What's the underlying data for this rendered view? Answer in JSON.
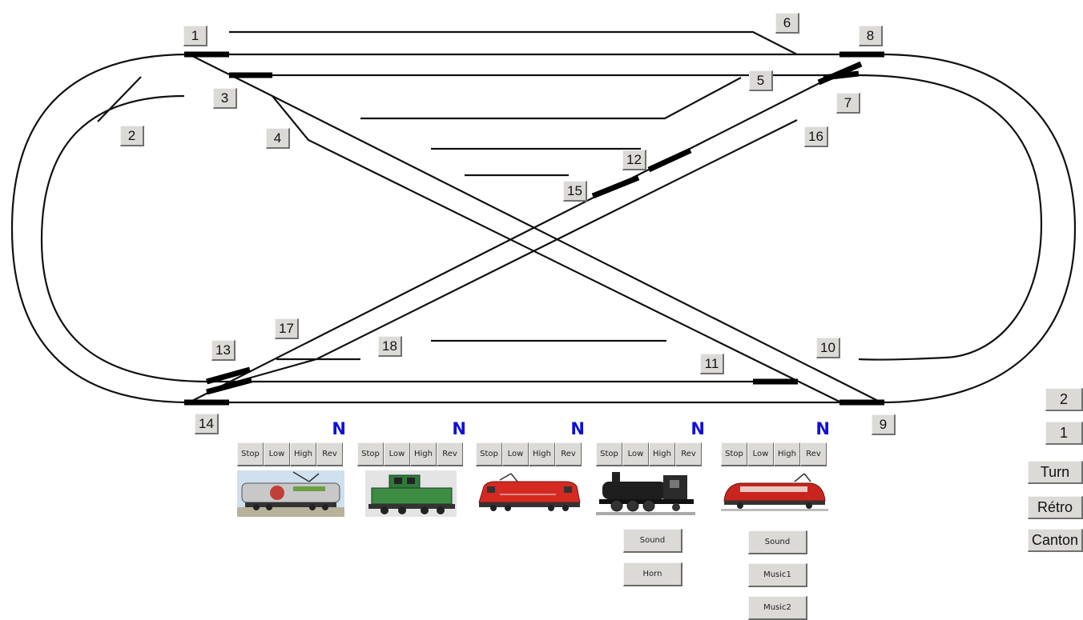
{
  "switches": [
    "1",
    "2",
    "3",
    "4",
    "5",
    "6",
    "7",
    "8",
    "9",
    "10",
    "11",
    "12",
    "13",
    "14",
    "15",
    "16",
    "17",
    "18"
  ],
  "locos": [
    {
      "direction": "N",
      "controls": [
        "Stop",
        "Low",
        "High",
        "Rev"
      ],
      "image": "locomotive-silver-electric",
      "extras": []
    },
    {
      "direction": "N",
      "controls": [
        "Stop",
        "Low",
        "High",
        "Rev"
      ],
      "image": "locomotive-green-diesel",
      "extras": []
    },
    {
      "direction": "N",
      "controls": [
        "Stop",
        "Low",
        "High",
        "Rev"
      ],
      "image": "locomotive-red-electric",
      "extras": []
    },
    {
      "direction": "N",
      "controls": [
        "Stop",
        "Low",
        "High",
        "Rev"
      ],
      "image": "locomotive-black-steam",
      "extras": [
        "Sound",
        "Horn"
      ]
    },
    {
      "direction": "N",
      "controls": [
        "Stop",
        "Low",
        "High",
        "Rev"
      ],
      "image": "railcar-red",
      "extras": [
        "Sound",
        "Music1",
        "Music2"
      ]
    }
  ],
  "side_buttons": [
    "2",
    "1",
    "Turn",
    "Rétro",
    "Canton"
  ],
  "colors": {
    "track": "#111111",
    "switch_blade": "#000000",
    "button_face": "#dcdad6",
    "direction_text": "#1010d8"
  }
}
